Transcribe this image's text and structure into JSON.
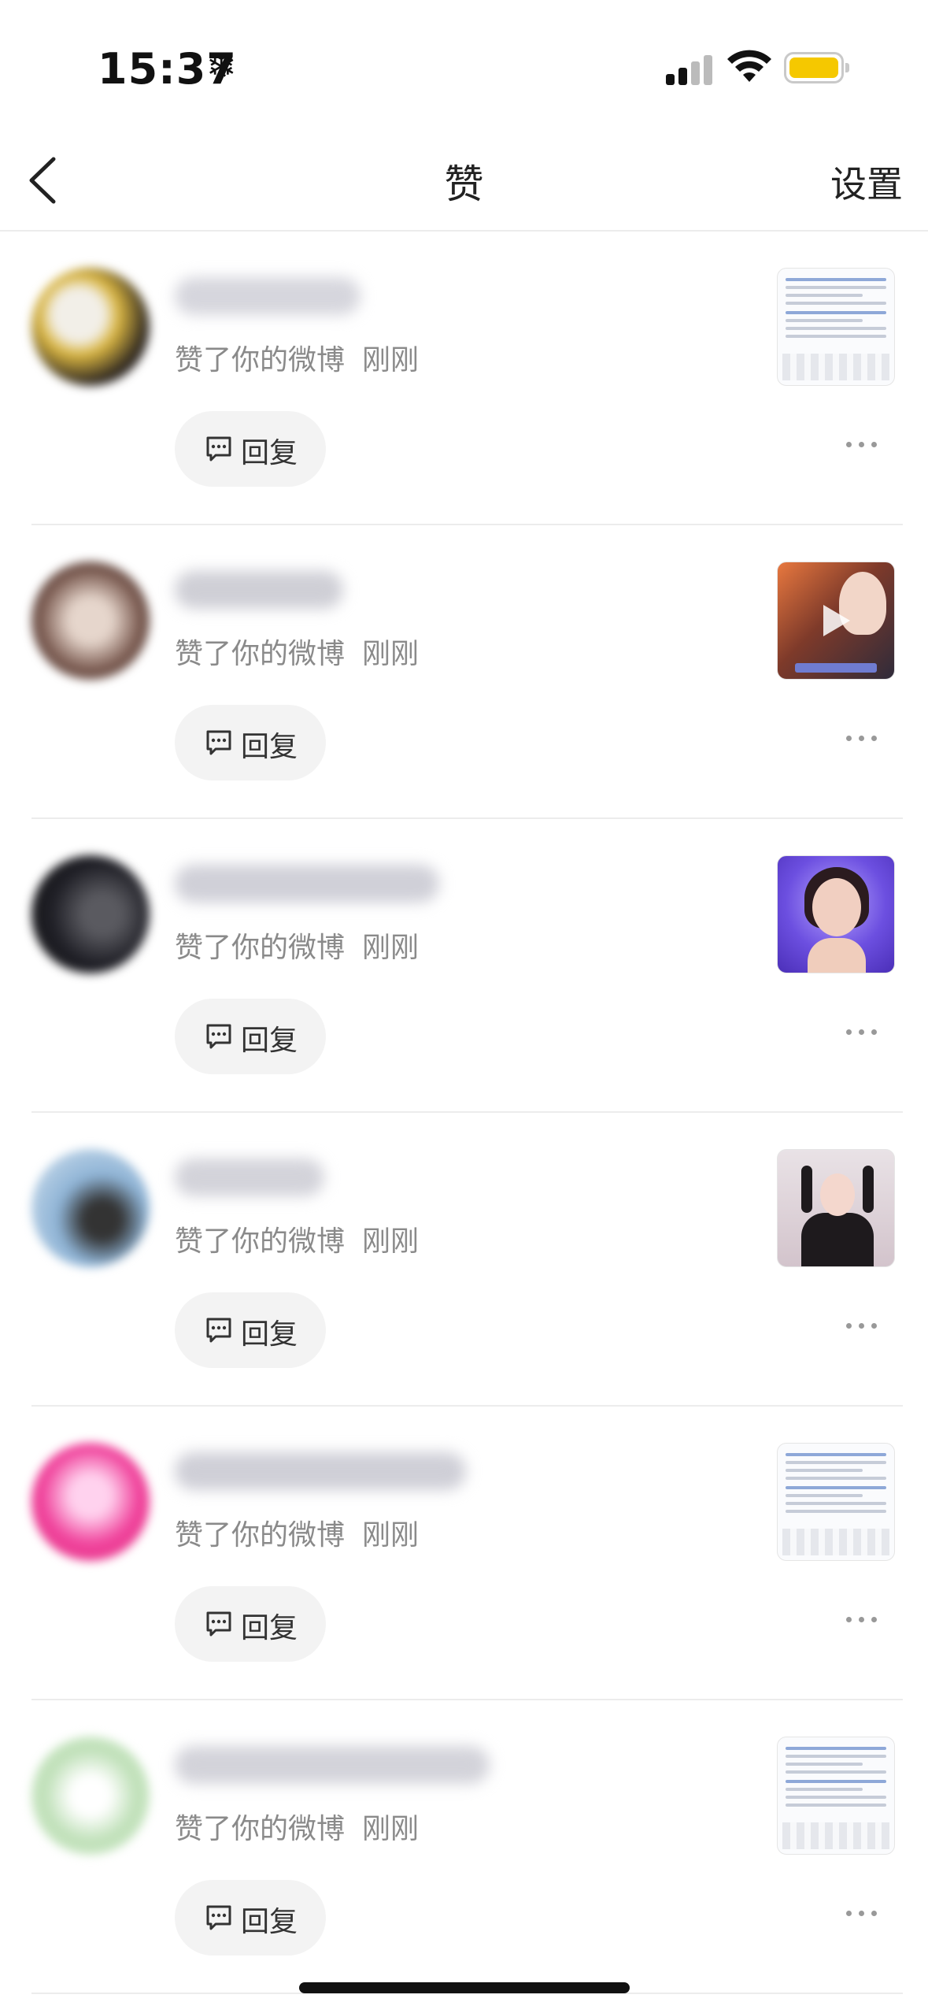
{
  "status_bar": {
    "time": "15:37",
    "time_icon": "snowflake-icon",
    "battery_color": "#f5c800"
  },
  "nav": {
    "back_icon": "chevron-left-icon",
    "title": "赞",
    "settings_label": "设置"
  },
  "items": [
    {
      "avatar_color": "#3a3028",
      "username_blur_color": "#d6d6dd",
      "description": "赞了你的微博",
      "time_ago": "刚刚",
      "reply_label": "回复",
      "thumbnail_type": "doc"
    },
    {
      "avatar_color": "#7a5a50",
      "username_blur_color": "#cfcfd6",
      "description": "赞了你的微博",
      "time_ago": "刚刚",
      "reply_label": "回复",
      "thumbnail_type": "video"
    },
    {
      "avatar_color": "#1f1f26",
      "username_blur_color": "#d0d0d8",
      "description": "赞了你的微博",
      "time_ago": "刚刚",
      "reply_label": "回复",
      "thumbnail_type": "purple"
    },
    {
      "avatar_color": "#8fb4d6",
      "username_blur_color": "#d3d3da",
      "description": "赞了你的微博",
      "time_ago": "刚刚",
      "reply_label": "回复",
      "thumbnail_type": "pinkroom"
    },
    {
      "avatar_color": "#f0439c",
      "username_blur_color": "#cfcfd7",
      "description": "赞了你的微博",
      "time_ago": "刚刚",
      "reply_label": "回复",
      "thumbnail_type": "doc"
    },
    {
      "avatar_color": "#bfe0b8",
      "username_blur_color": "#d3d3da",
      "description": "赞了你的微博",
      "time_ago": "刚刚",
      "reply_label": "回复",
      "thumbnail_type": "doc"
    }
  ]
}
